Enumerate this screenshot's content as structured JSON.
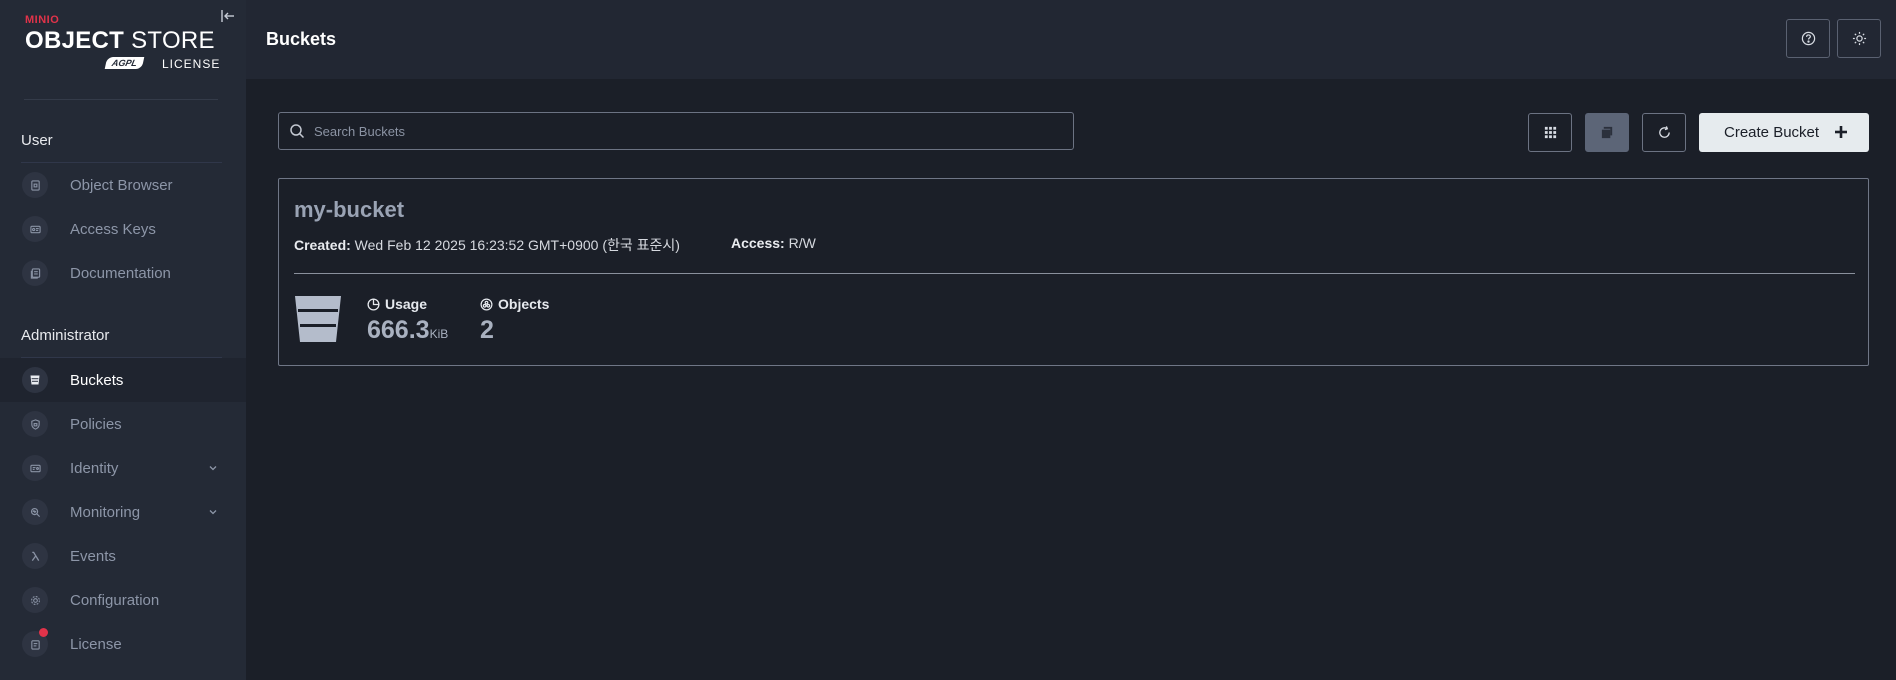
{
  "logo": {
    "brand": "MINIO",
    "product_bold": "OBJECT",
    "product_rest": " STORE",
    "edition": "AGPL",
    "license": "LICENSE"
  },
  "sidebar": {
    "user_section": "User",
    "user_items": [
      {
        "label": "Object Browser",
        "icon": "object-browser-icon"
      },
      {
        "label": "Access Keys",
        "icon": "access-keys-icon"
      },
      {
        "label": "Documentation",
        "icon": "documentation-icon"
      }
    ],
    "admin_section": "Administrator",
    "admin_items": [
      {
        "label": "Buckets",
        "icon": "bucket-icon",
        "active": true
      },
      {
        "label": "Policies",
        "icon": "shield-icon"
      },
      {
        "label": "Identity",
        "icon": "identity-icon",
        "expandable": true
      },
      {
        "label": "Monitoring",
        "icon": "monitoring-icon",
        "expandable": true
      },
      {
        "label": "Events",
        "icon": "lambda-icon"
      },
      {
        "label": "Configuration",
        "icon": "gear-icon"
      },
      {
        "label": "License",
        "icon": "license-icon",
        "notification": true
      }
    ]
  },
  "header": {
    "title": "Buckets"
  },
  "toolbar": {
    "search_placeholder": "Search Buckets",
    "create_label": "Create Bucket"
  },
  "bucket": {
    "name": "my-bucket",
    "created_label": "Created:",
    "created_value": " Wed Feb 12 2025 16:23:52 GMT+0900 (한국 표준시)",
    "access_label": "Access:",
    "access_value": " R/W",
    "usage_label": "Usage",
    "usage_value": "666.3",
    "usage_unit": "KiB",
    "objects_label": "Objects",
    "objects_value": "2"
  },
  "colors": {
    "accent_red": "#e1334a",
    "sidebar_bg": "#242a36",
    "main_bg": "#1b1f28"
  }
}
